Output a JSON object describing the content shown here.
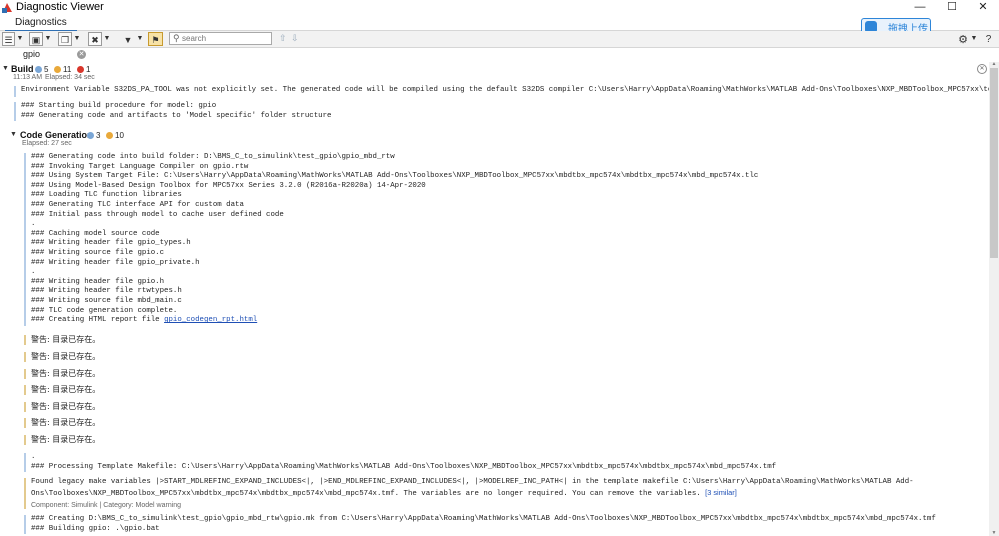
{
  "window": {
    "title": "Diagnostic Viewer",
    "minimize": "—",
    "maximize": "☐",
    "close": "✕"
  },
  "tabs": {
    "diagnostics": "Diagnostics"
  },
  "upload": {
    "label": "拖拽上传"
  },
  "toolbar": {
    "search_placeholder": "search"
  },
  "filter": {
    "tab": "gpio"
  },
  "build": {
    "title": "Build",
    "info_count": "5",
    "warn_count": "11",
    "error_count": "1",
    "time": "11:13 AM",
    "elapsed": "Elapsed: 34 sec",
    "line1": "Environment Variable S32DS_PA_TOOL was not explicitly set. The generated code will be compiled using the default S32DS compiler C:\\Users\\Harry\\AppData\\Roaming\\MathWorks\\MATLAB Add-Ons\\Toolboxes\\NXP_MBDToolbox_MPC57xx\\tools",
    "lines2": [
      "### Starting build procedure for model: gpio",
      "### Generating code and artifacts to 'Model specific' folder structure"
    ]
  },
  "codegen": {
    "title": "Code Generation",
    "info_count": "3",
    "warn_count": "10",
    "elapsed": "Elapsed: 27 sec",
    "lines": [
      "### Generating code into build folder: D:\\BMS_C_to_simulink\\test_gpio\\gpio_mbd_rtw",
      "### Invoking Target Language Compiler on gpio.rtw",
      "### Using System Target File: C:\\Users\\Harry\\AppData\\Roaming\\MathWorks\\MATLAB Add-Ons\\Toolboxes\\NXP_MBDToolbox_MPC57xx\\mbdtbx_mpc574x\\mbdtbx_mpc574x\\mbd_mpc574x.tlc",
      "### Using Model-Based Design Toolbox for MPC57xx Series 3.2.0 (R2016a-R2020a) 14-Apr-2020",
      "### Loading TLC function libraries",
      "### Generating TLC interface API for custom data",
      "### Initial pass through model to cache user defined code",
      ".",
      "### Caching model source code",
      "### Writing header file gpio_types.h",
      "### Writing source file gpio.c",
      "### Writing header file gpio_private.h",
      ".",
      "### Writing header file gpio.h",
      "### Writing header file rtwtypes.h",
      "### Writing source file mbd_main.c",
      "### TLC code generation complete."
    ],
    "report_prefix": "### Creating HTML report file ",
    "report_link": "gpio_codegen_rpt.html",
    "warnings": [
      "警告: 目录已存在。",
      "警告: 目录已存在。",
      "警告: 目录已存在。",
      "警告: 目录已存在。",
      "警告: 目录已存在。",
      "警告: 目录已存在。",
      "警告: 目录已存在。"
    ],
    "template_lines": [
      ".",
      "### Processing Template Makefile: C:\\Users\\Harry\\AppData\\Roaming\\MathWorks\\MATLAB Add-Ons\\Toolboxes\\NXP_MBDToolbox_MPC57xx\\mbdtbx_mpc574x\\mbdtbx_mpc574x\\mbd_mpc574x.tmf"
    ],
    "legacy_line1": "Found legacy make variables |>START_MDLREFINC_EXPAND_INCLUDES<|, |>END_MDLREFINC_EXPAND_INCLUDES<|, |>MODELREF_INC_PATH<| in the template makefile C:\\Users\\Harry\\AppData\\Roaming\\MathWorks\\MATLAB Add-",
    "legacy_line2": "Ons\\Toolboxes\\NXP_MBDToolbox_MPC57xx\\mbdtbx_mpc574x\\mbdtbx_mpc574x\\mbd_mpc574x.tmf. The variables are no longer required. You can remove the variables. ",
    "similar_link": "[3 similar]",
    "component": "Component:  Simulink | Category:  Model warning",
    "final_lines": [
      "### Creating D:\\BMS_C_to_simulink\\test_gpio\\gpio_mbd_rtw\\gpio.mk from C:\\Users\\Harry\\AppData\\Roaming\\MathWorks\\MATLAB Add-Ons\\Toolboxes\\NXP_MBDToolbox_MPC57xx\\mbdtbx_mpc574x\\mbdtbx_mpc574x\\mbd_mpc574x.tmf",
      "### Building gpio: .\\gpio.bat"
    ]
  },
  "colors": {
    "accent": "#2f6fb3",
    "warning": "#e9a93a",
    "error": "#d9362b",
    "info": "#7aa6d6"
  }
}
